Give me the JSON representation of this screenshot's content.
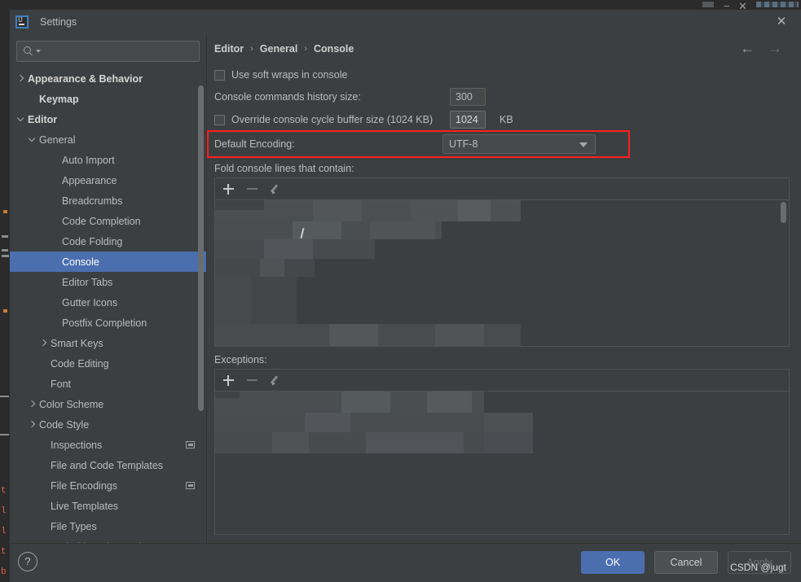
{
  "window": {
    "title": "Settings",
    "logo_icon": "intellij-idea-logo-icon",
    "close_icon": "close-icon"
  },
  "sidebar": {
    "search": {
      "placeholder": "",
      "value": "",
      "icon": "search-icon",
      "caret_icon": "chevron-down-icon"
    },
    "items": [
      {
        "label": "Appearance & Behavior",
        "indent": 0,
        "arrow": "right",
        "bold": true,
        "selected": false,
        "badge": false
      },
      {
        "label": "Keymap",
        "indent": 1,
        "arrow": "none",
        "bold": true,
        "selected": false,
        "badge": false
      },
      {
        "label": "Editor",
        "indent": 0,
        "arrow": "down",
        "bold": true,
        "selected": false,
        "badge": false
      },
      {
        "label": "General",
        "indent": 1,
        "arrow": "down",
        "bold": false,
        "selected": false,
        "badge": false
      },
      {
        "label": "Auto Import",
        "indent": 3,
        "arrow": "none",
        "bold": false,
        "selected": false,
        "badge": false
      },
      {
        "label": "Appearance",
        "indent": 3,
        "arrow": "none",
        "bold": false,
        "selected": false,
        "badge": false
      },
      {
        "label": "Breadcrumbs",
        "indent": 3,
        "arrow": "none",
        "bold": false,
        "selected": false,
        "badge": false
      },
      {
        "label": "Code Completion",
        "indent": 3,
        "arrow": "none",
        "bold": false,
        "selected": false,
        "badge": false
      },
      {
        "label": "Code Folding",
        "indent": 3,
        "arrow": "none",
        "bold": false,
        "selected": false,
        "badge": false
      },
      {
        "label": "Console",
        "indent": 3,
        "arrow": "none",
        "bold": false,
        "selected": true,
        "badge": false
      },
      {
        "label": "Editor Tabs",
        "indent": 3,
        "arrow": "none",
        "bold": false,
        "selected": false,
        "badge": false
      },
      {
        "label": "Gutter Icons",
        "indent": 3,
        "arrow": "none",
        "bold": false,
        "selected": false,
        "badge": false
      },
      {
        "label": "Postfix Completion",
        "indent": 3,
        "arrow": "none",
        "bold": false,
        "selected": false,
        "badge": false
      },
      {
        "label": "Smart Keys",
        "indent": 2,
        "arrow": "right",
        "bold": false,
        "selected": false,
        "badge": false
      },
      {
        "label": "Code Editing",
        "indent": 2,
        "arrow": "none",
        "bold": false,
        "selected": false,
        "badge": false
      },
      {
        "label": "Font",
        "indent": 2,
        "arrow": "none",
        "bold": false,
        "selected": false,
        "badge": false
      },
      {
        "label": "Color Scheme",
        "indent": 1,
        "arrow": "right",
        "bold": false,
        "selected": false,
        "badge": false
      },
      {
        "label": "Code Style",
        "indent": 1,
        "arrow": "right",
        "bold": false,
        "selected": false,
        "badge": false
      },
      {
        "label": "Inspections",
        "indent": 2,
        "arrow": "none",
        "bold": false,
        "selected": false,
        "badge": true
      },
      {
        "label": "File and Code Templates",
        "indent": 2,
        "arrow": "none",
        "bold": false,
        "selected": false,
        "badge": false
      },
      {
        "label": "File Encodings",
        "indent": 2,
        "arrow": "none",
        "bold": false,
        "selected": false,
        "badge": true
      },
      {
        "label": "Live Templates",
        "indent": 2,
        "arrow": "none",
        "bold": false,
        "selected": false,
        "badge": false
      },
      {
        "label": "File Types",
        "indent": 2,
        "arrow": "none",
        "bold": false,
        "selected": false,
        "badge": false
      },
      {
        "label": "Android Design Tools",
        "indent": 2,
        "arrow": "none",
        "bold": false,
        "selected": false,
        "badge": false
      }
    ]
  },
  "main": {
    "breadcrumb": [
      "Editor",
      "General",
      "Console"
    ],
    "breadcrumb_separator": "›",
    "nav": {
      "back_icon": "arrow-left-icon",
      "back_glyph": "←",
      "forward_icon": "arrow-right-icon",
      "forward_glyph": "→"
    },
    "soft_wraps": {
      "label": "Use soft wraps in console",
      "checked": false
    },
    "history_size": {
      "label": "Console commands history size:",
      "value": "300"
    },
    "cycle_buffer": {
      "label": "Override console cycle buffer size (1024 KB)",
      "checked": false,
      "value": "1024",
      "unit": "KB"
    },
    "default_encoding": {
      "label": "Default Encoding:",
      "value": "UTF-8",
      "dropdown_icon": "chevron-down-icon",
      "highlight_color": "#fe1e1e"
    },
    "fold_section": {
      "label": "Fold console lines that contain:",
      "toolbar": [
        {
          "name": "add-icon",
          "glyph": "+",
          "enabled": true
        },
        {
          "name": "remove-icon",
          "glyph": "−",
          "enabled": false
        },
        {
          "name": "edit-pencil-icon",
          "glyph": "✎",
          "enabled": false
        }
      ]
    },
    "exceptions_section": {
      "label": "Exceptions:",
      "toolbar": [
        {
          "name": "add-icon",
          "glyph": "+",
          "enabled": true
        },
        {
          "name": "remove-icon",
          "glyph": "−",
          "enabled": false
        },
        {
          "name": "edit-pencil-icon",
          "glyph": "✎",
          "enabled": false
        }
      ]
    }
  },
  "footer": {
    "help_label": "?",
    "ok_label": "OK",
    "cancel_label": "Cancel",
    "apply_label": "Apply",
    "apply_enabled": false,
    "watermark": "CSDN @jugt"
  },
  "colors": {
    "dialog_bg": "#3c3f41",
    "selection_blue": "#4b6eaf",
    "text": "#bbbbbb",
    "highlight_red": "#fe1e1e",
    "field_bg": "#45494a"
  }
}
